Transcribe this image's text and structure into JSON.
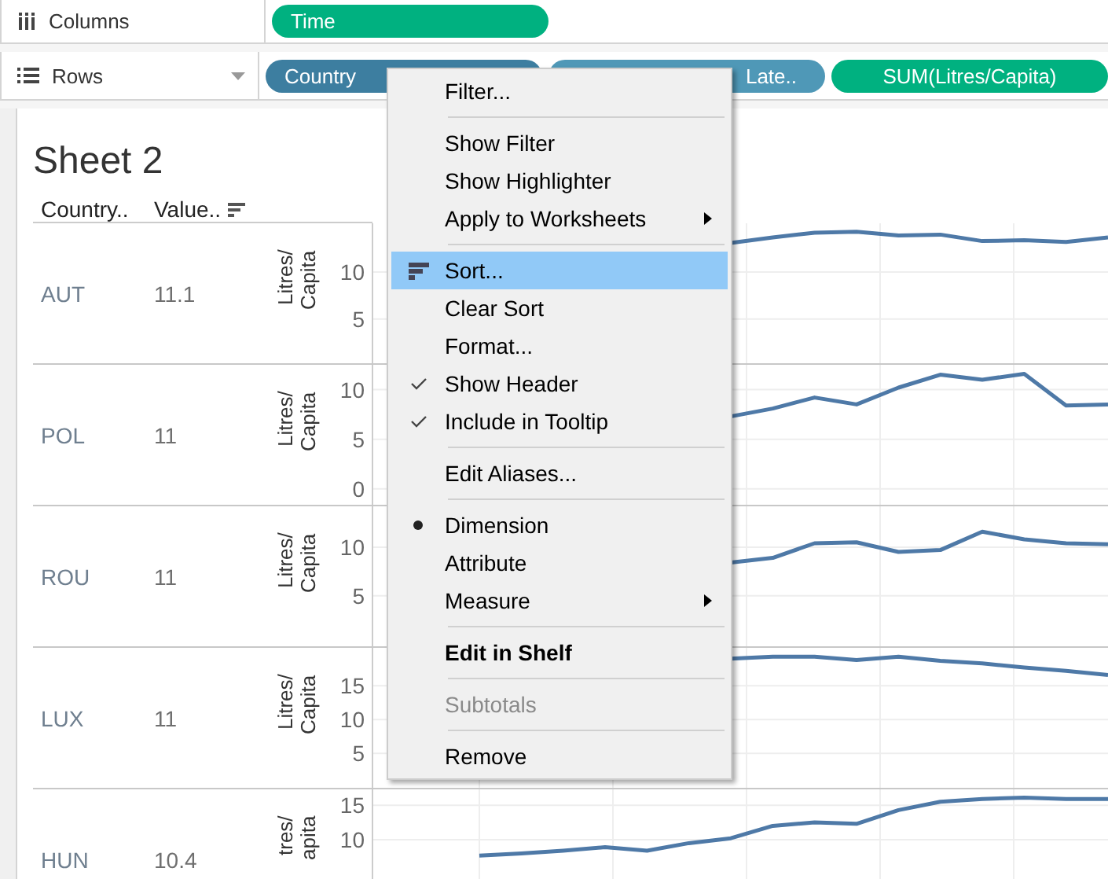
{
  "columns_shelf": {
    "label": "Columns",
    "pills": [
      {
        "text": "Time",
        "kind": "continuous"
      }
    ]
  },
  "rows_shelf": {
    "label": "Rows",
    "pills": [
      {
        "text": "Country",
        "kind": "dimension"
      },
      {
        "text": "Late..",
        "kind": "measure"
      },
      {
        "text": "SUM(Litres/Capita)",
        "kind": "continuous"
      }
    ]
  },
  "sheet": {
    "title": "Sheet 2",
    "headers": [
      "Country..",
      "Value.."
    ],
    "rows": [
      {
        "country": "AUT",
        "value": "11.1",
        "chart_data": {
          "type": "line",
          "ylabel": "Litres/ Capita",
          "ylim": [
            0.3,
            15.2
          ],
          "grid": true,
          "yticks": [
            10,
            5
          ],
          "series": [
            {
              "color": "#4e79a7",
              "values": [
                null,
                null,
                null,
                null,
                null,
                null,
                13.1,
                13.7,
                14.2,
                14.3,
                13.9,
                14.0,
                13.3,
                13.4,
                13.2,
                13.7
              ]
            }
          ]
        }
      },
      {
        "country": "POL",
        "value": "11",
        "chart_data": {
          "type": "line",
          "ylabel": "Litres/ Capita",
          "ylim": [
            -1.6,
            12.5
          ],
          "grid": true,
          "yticks": [
            10,
            5,
            0
          ],
          "series": [
            {
              "color": "#4e79a7",
              "values": [
                null,
                null,
                null,
                null,
                null,
                null,
                7.3,
                8.1,
                9.2,
                8.5,
                10.2,
                11.5,
                11.0,
                11.6,
                8.4,
                8.5
              ]
            }
          ]
        }
      },
      {
        "country": "ROU",
        "value": "11",
        "chart_data": {
          "type": "line",
          "ylabel": "Litres/ Capita",
          "ylim": [
            -0.2,
            14.2
          ],
          "grid": true,
          "yticks": [
            10,
            5
          ],
          "series": [
            {
              "color": "#4e79a7",
              "values": [
                null,
                null,
                null,
                null,
                null,
                null,
                8.4,
                8.9,
                10.4,
                10.5,
                9.5,
                9.7,
                11.6,
                10.8,
                10.4,
                10.3
              ]
            }
          ]
        }
      },
      {
        "country": "LUX",
        "value": "11",
        "chart_data": {
          "type": "line",
          "ylabel": "Litres/ Capita",
          "ylim": [
            -0.1,
            20.6
          ],
          "grid": true,
          "yticks": [
            15,
            10,
            5
          ],
          "series": [
            {
              "color": "#4e79a7",
              "values": [
                null,
                null,
                null,
                null,
                null,
                null,
                19.0,
                19.3,
                19.3,
                18.8,
                19.3,
                18.7,
                18.3,
                17.7,
                17.2,
                16.6
              ]
            }
          ]
        }
      },
      {
        "country": "HUN",
        "value": "10.4",
        "chart_data": {
          "type": "line",
          "ylabel": "tres/ apita",
          "ylim": [
            -3,
            17.3
          ],
          "grid": true,
          "yticks": [
            15,
            10
          ],
          "series": [
            {
              "color": "#4e79a7",
              "values": [
                7.7,
                8.0,
                8.4,
                8.9,
                8.4,
                9.5,
                10.2,
                12.0,
                12.5,
                12.3,
                14.3,
                15.5,
                15.9,
                16.1,
                15.9,
                15.9
              ]
            }
          ]
        }
      }
    ]
  },
  "context_menu": {
    "items": [
      {
        "kind": "item",
        "label": "Filter...",
        "selected": false
      },
      {
        "kind": "separator"
      },
      {
        "kind": "item",
        "label": "Show Filter",
        "selected": false
      },
      {
        "kind": "item",
        "label": "Show Highlighter",
        "selected": false
      },
      {
        "kind": "submenu",
        "label": "Apply to Worksheets",
        "selected": false
      },
      {
        "kind": "separator"
      },
      {
        "kind": "sort",
        "label": "Sort...",
        "selected": true
      },
      {
        "kind": "item",
        "label": "Clear Sort",
        "selected": false
      },
      {
        "kind": "item",
        "label": "Format...",
        "selected": false
      },
      {
        "kind": "check",
        "label": "Show Header",
        "checked": true,
        "selected": false
      },
      {
        "kind": "check",
        "label": "Include in Tooltip",
        "checked": true,
        "selected": false
      },
      {
        "kind": "separator"
      },
      {
        "kind": "item",
        "label": "Edit Aliases...",
        "selected": false
      },
      {
        "kind": "separator"
      },
      {
        "kind": "radio",
        "label": "Dimension",
        "checked": true,
        "selected": false
      },
      {
        "kind": "radio",
        "label": "Attribute",
        "checked": false,
        "selected": false
      },
      {
        "kind": "submenu",
        "label": "Measure",
        "selected": false
      },
      {
        "kind": "separator"
      },
      {
        "kind": "bold",
        "label": "Edit in Shelf",
        "selected": false
      },
      {
        "kind": "separator"
      },
      {
        "kind": "item",
        "label": "Subtotals",
        "selected": false,
        "disabled": true
      },
      {
        "kind": "separator"
      },
      {
        "kind": "item",
        "label": "Remove",
        "selected": false
      }
    ]
  }
}
